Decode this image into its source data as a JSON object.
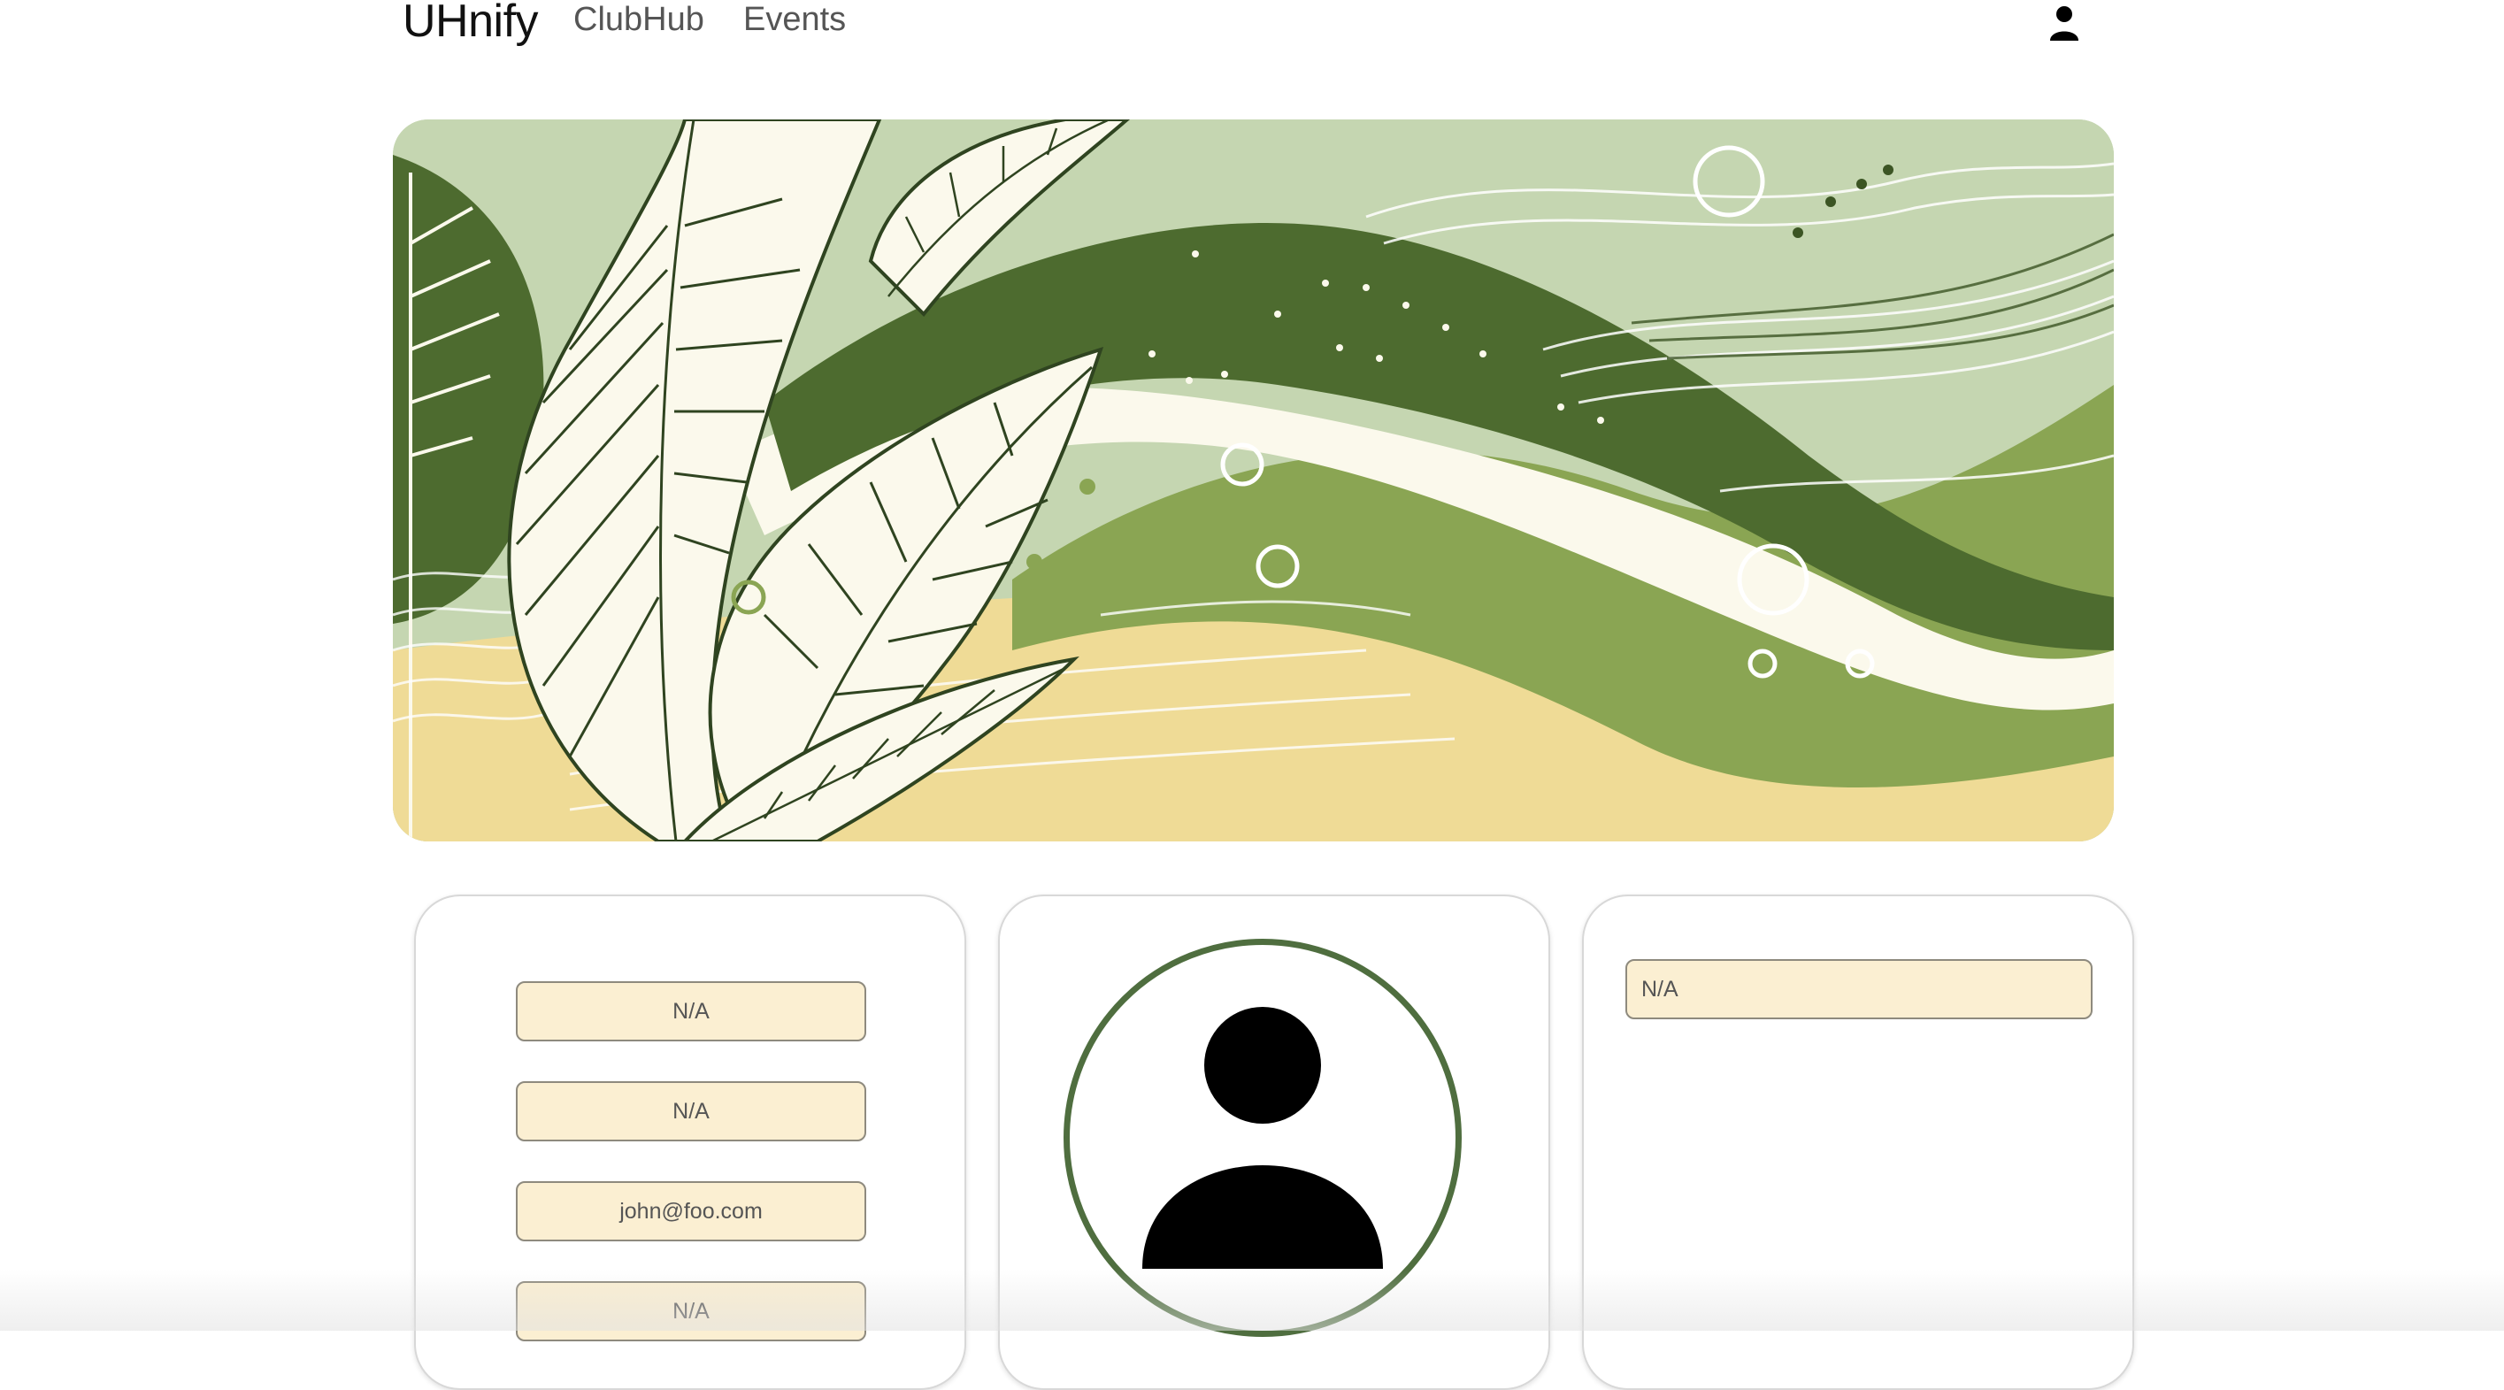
{
  "navbar": {
    "brand": "UHnify",
    "links": [
      {
        "label": "ClubHub"
      },
      {
        "label": "Events"
      }
    ],
    "profile_icon": "person-icon"
  },
  "banner": {
    "image": "abstract-leaves-waves-illustration",
    "colors": {
      "sage": "#c5d6b1",
      "dark_green": "#4d6b2f",
      "olive": "#8aa553",
      "cream": "#fbf9ec",
      "sand": "#efdb96"
    }
  },
  "profile": {
    "left_card": {
      "fields": [
        {
          "value": "N/A"
        },
        {
          "value": "N/A"
        },
        {
          "value": "john@foo.com"
        },
        {
          "value": "N/A"
        }
      ]
    },
    "avatar": {
      "icon": "person-icon",
      "ring_color": "#4f6e3f"
    },
    "right_card": {
      "field": {
        "value": "N/A"
      }
    }
  }
}
